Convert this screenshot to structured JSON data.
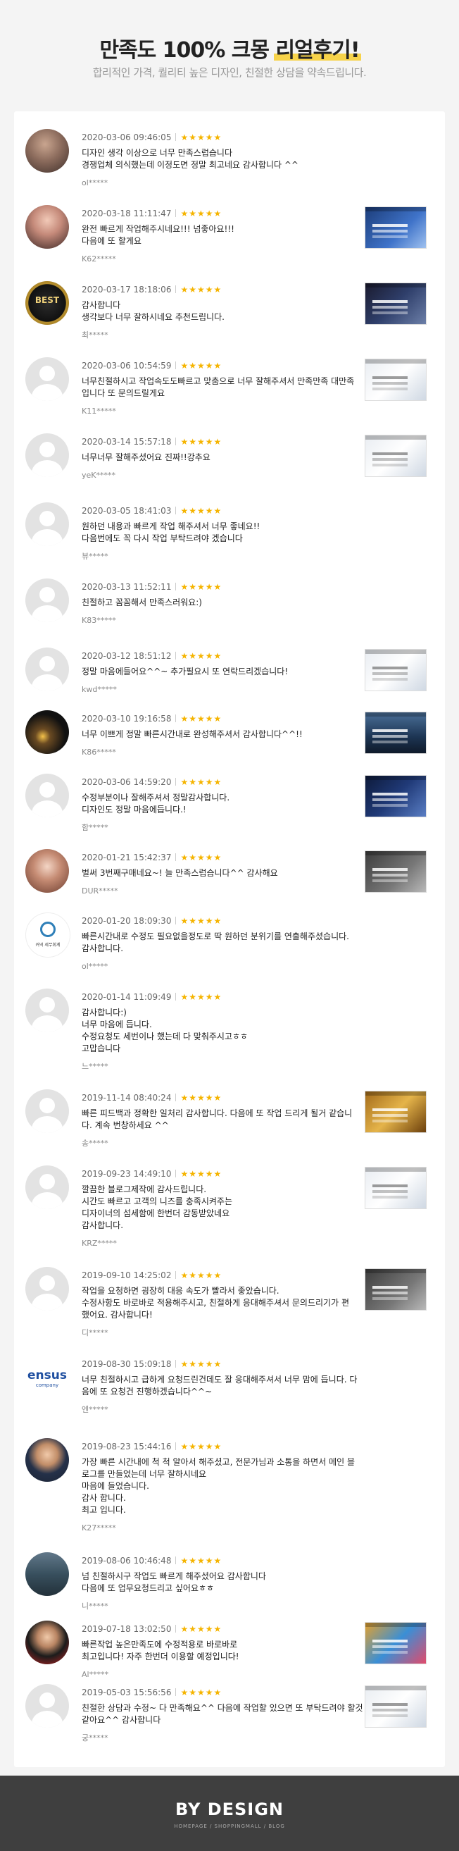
{
  "header": {
    "title_prefix": "만족도 100% 크몽 ",
    "title_highlight": "리얼후기!",
    "subtitle": "합리적인 가격, 퀄리티 높은 디자인, 친절한 상담을 약속드립니다."
  },
  "reviews": [
    {
      "date": "2020-03-06 09:46:05",
      "stars": "★★★★★",
      "lines": [
        "디자인 생각 이상으로 너무 만족스럽습니다",
        "경쟁업체 의식했는데 이정도면 정말 최고네요 감사합니다 ^^"
      ],
      "author": "ol*****"
    },
    {
      "date": "2020-03-18 11:11:47",
      "stars": "★★★★★",
      "lines": [
        "완전 빠르게 작업해주시네요!!! 넘좋아요!!!",
        "다음에 또 할게요"
      ],
      "author": "K62*****"
    },
    {
      "date": "2020-03-17 18:18:06",
      "stars": "★★★★★",
      "lines": [
        "감사합니다",
        "생각보다 너무 잘하시네요 추천드립니다."
      ],
      "author": "최*****"
    },
    {
      "date": "2020-03-06 10:54:59",
      "stars": "★★★★★",
      "lines": [
        "너무친절하시고 작업속도도빠르고 맞춤으로 너무 잘해주셔서 만족만족 대만족",
        "입니다 또 문의드릴게요"
      ],
      "author": "K11*****"
    },
    {
      "date": "2020-03-14 15:57:18",
      "stars": "★★★★★",
      "lines": [
        "너무너무 잘해주셨어요 진짜!!강추요"
      ],
      "author": "yeK*****"
    },
    {
      "date": "2020-03-05 18:41:03",
      "stars": "★★★★★",
      "lines": [
        "원하던 내용과 빠르게 작업 해주셔서 너무 좋네요!!",
        "다음번에도 꼭 다시 작업 부탁드려야 겠습니다"
      ],
      "author": "뷰*****"
    },
    {
      "date": "2020-03-13 11:52:11",
      "stars": "★★★★★",
      "lines": [
        "친절하고 꼼꼼해서 만족스러워요:)"
      ],
      "author": "K83*****"
    },
    {
      "date": "2020-03-12 18:51:12",
      "stars": "★★★★★",
      "lines": [
        "정말 마음에들어요^^~ 추가필요시 또 연락드리겠습니다!"
      ],
      "author": "kwd*****"
    },
    {
      "date": "2020-03-10 19:16:58",
      "stars": "★★★★★",
      "lines": [
        "너무 이쁘게 정말 빠른시간내로 완성해주셔서 감사합니다^^!!"
      ],
      "author": "K86*****"
    },
    {
      "date": "2020-03-06 14:59:20",
      "stars": "★★★★★",
      "lines": [
        "수정부분이나 잘해주셔서 정말감사합니다.",
        "디자인도 정말 마음에듭니다.!"
      ],
      "author": "함*****"
    },
    {
      "date": "2020-01-21 15:42:37",
      "stars": "★★★★★",
      "lines": [
        "벌써 3번째구매네요~! 늘 만족스럽습니다^^ 감사해요"
      ],
      "author": "DUR*****"
    },
    {
      "date": "2020-01-20 18:09:30",
      "stars": "★★★★★",
      "lines": [
        "빠른시간내로 수정도 필요없을정도로 딱 원하던 분위기를 연출해주셨습니다.",
        "감사합니다."
      ],
      "author": "ol*****"
    },
    {
      "date": "2020-01-14 11:09:49",
      "stars": "★★★★★",
      "lines": [
        "감사합니다:)",
        "너무 마음에 듭니다.",
        "수정요청도 세번이나 했는데 다 맞춰주시고ㅎㅎ",
        "고맙습니다"
      ],
      "author": "느*****"
    },
    {
      "date": "2019-11-14 08:40:24",
      "stars": "★★★★★",
      "lines": [
        "빠른 피드백과 정확한 일처리 감사합니다. 다음에 또 작업 드리게 될거 같습니",
        "다. 계속 번창하세요 ^^"
      ],
      "author": "송*****"
    },
    {
      "date": "2019-09-23 14:49:10",
      "stars": "★★★★★",
      "lines": [
        "깔끔한 블로그제작에 감사드립니다.",
        "시간도 빠르고 고객의 니즈를 충족시켜주는",
        "디자이너의 섬세함에 한번더 감동받았네요",
        "감사합니다."
      ],
      "author": "KRZ*****"
    },
    {
      "date": "2019-09-10 14:25:02",
      "stars": "★★★★★",
      "lines": [
        "작업을 요청하면 굉장히 대응 속도가 빨라서 좋았습니다.",
        "수정사항도 바로바로 적용해주시고, 친절하게 응대해주셔서 문의드리기가 편",
        "했어요. 감사합니다!"
      ],
      "author": "디*****"
    },
    {
      "date": "2019-08-30 15:09:18",
      "stars": "★★★★★",
      "lines": [
        "너무 친절하시고 급하게 요청드린건데도 잘 응대해주셔서 너무 맘에 듭니다. 다",
        "음에 또 요청건 진행하겠습니다^^~"
      ],
      "author": "엔*****"
    },
    {
      "date": "2019-08-23 15:44:16",
      "stars": "★★★★★",
      "lines": [
        "가장 빠른 시간내에 척 척 알아서 해주셨고, 전문가님과 소통을 하면서 메인 블",
        "로그를 만들었는데 너무 잘하시네요",
        "마음에 들었습니다.",
        "감사 합니다.",
        "최고 입니다."
      ],
      "author": "K27*****"
    },
    {
      "date": "2019-08-06 10:46:48",
      "stars": "★★★★★",
      "lines": [
        "넘 친절하시구 작업도 빠르게 해주셨어요 감사합니다",
        "다음에 또 업무요청드리고 싶어요ㅎㅎ"
      ],
      "author": "니*****"
    },
    {
      "date": "2019-07-18 13:02:50",
      "stars": "★★★★★",
      "lines": [
        "빠른작업 높은만족도에 수정적용로 바로바로",
        "최고입니다! 자주 한번더 이용할 예정입니다!"
      ],
      "author": "Al*****"
    },
    {
      "date": "2019-05-03 15:56:56",
      "stars": "★★★★★",
      "lines": [
        "친절한 상담과 수정~ 다 만족해요^^ 다음에 작업할 있으면 또 부탁드려야 할것",
        "같아요^^ 감사합니다"
      ],
      "author": "궁*****"
    }
  ],
  "footer": {
    "brand": "BY DESIGN",
    "sub": "HOMEPAGE / SHOPPINGMALL / BLOG"
  }
}
